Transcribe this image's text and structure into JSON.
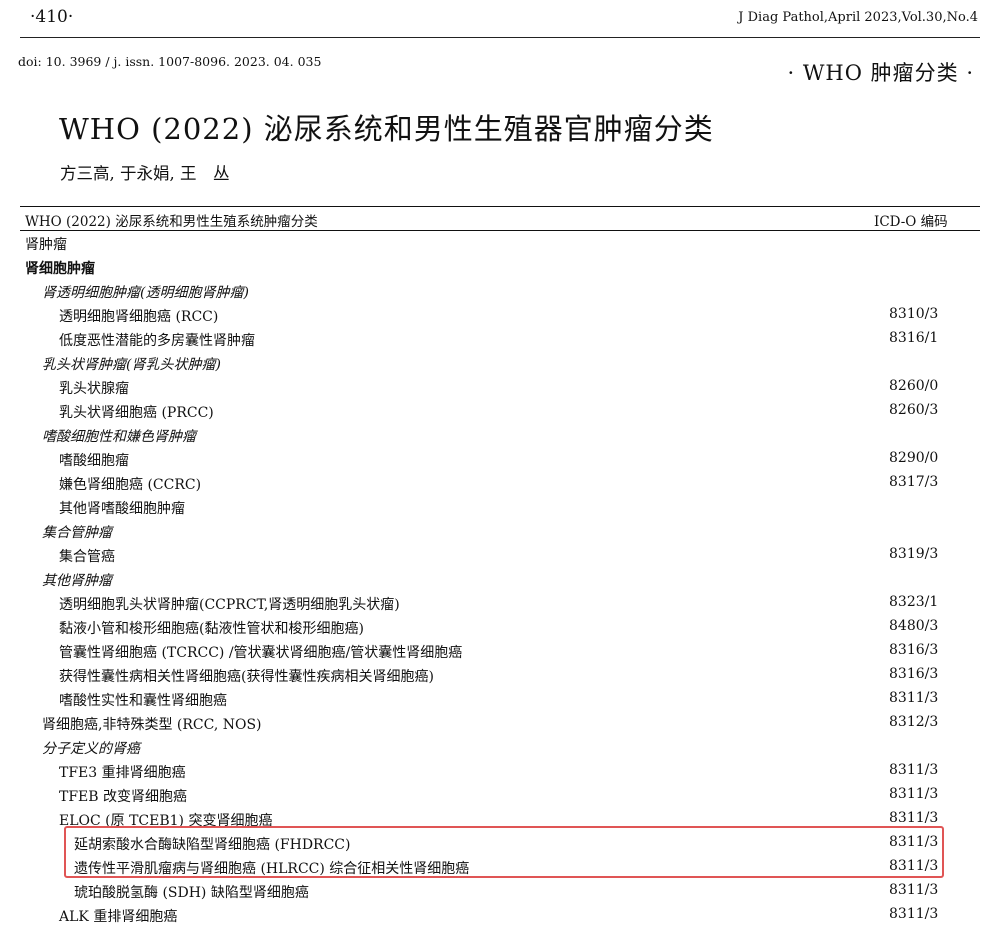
{
  "header": {
    "page_number": "·410·",
    "journal": "J Diag Pathol,April 2023,Vol.30,No.4",
    "doi": "doi: 10. 3969 / j. issn. 1007-8096. 2023. 04. 035",
    "category": "· WHO 肿瘤分类 ·"
  },
  "article": {
    "title": "WHO (2022) 泌尿系统和男性生殖器官肿瘤分类",
    "authors": "方三高, 于永娟, 王　丛"
  },
  "table": {
    "header_left": "WHO (2022) 泌尿系统和男性生殖系统肿瘤分类",
    "header_right": "ICD-O 编码",
    "rows": [
      {
        "name": "肾肿瘤",
        "code": ""
      },
      {
        "name": "肾细胞肿瘤",
        "code": ""
      },
      {
        "name": "肾透明细胞肿瘤(透明细胞肾肿瘤)",
        "code": ""
      },
      {
        "name": "透明细胞肾细胞癌 (RCC)",
        "code": "8310/3"
      },
      {
        "name": "低度恶性潜能的多房囊性肾肿瘤",
        "code": "8316/1"
      },
      {
        "name": "乳头状肾肿瘤(肾乳头状肿瘤)",
        "code": ""
      },
      {
        "name": "乳头状腺瘤",
        "code": "8260/0"
      },
      {
        "name": "乳头状肾细胞癌 (PRCC)",
        "code": "8260/3"
      },
      {
        "name": "嗜酸细胞性和嫌色肾肿瘤",
        "code": ""
      },
      {
        "name": "嗜酸细胞瘤",
        "code": "8290/0"
      },
      {
        "name": "嫌色肾细胞癌 (CCRC)",
        "code": "8317/3"
      },
      {
        "name": "其他肾嗜酸细胞肿瘤",
        "code": ""
      },
      {
        "name": "集合管肿瘤",
        "code": ""
      },
      {
        "name": "集合管癌",
        "code": "8319/3"
      },
      {
        "name": "其他肾肿瘤",
        "code": ""
      },
      {
        "name": "透明细胞乳头状肾肿瘤(CCPRCT,肾透明细胞乳头状瘤)",
        "code": "8323/1"
      },
      {
        "name": "黏液小管和梭形细胞癌(黏液性管状和梭形细胞癌)",
        "code": "8480/3"
      },
      {
        "name": "管囊性肾细胞癌 (TCRCC) /管状囊状肾细胞癌/管状囊性肾细胞癌",
        "code": "8316/3"
      },
      {
        "name": "获得性囊性病相关性肾细胞癌(获得性囊性疾病相关肾细胞癌)",
        "code": "8316/3"
      },
      {
        "name": "嗜酸性实性和囊性肾细胞癌",
        "code": "8311/3"
      },
      {
        "name": "肾细胞癌,非特殊类型 (RCC, NOS)",
        "code": "8312/3"
      },
      {
        "name": "分子定义的肾癌",
        "code": ""
      },
      {
        "name": "TFE3 重排肾细胞癌",
        "code": "8311/3"
      },
      {
        "name": "TFEB 改变肾细胞癌",
        "code": "8311/3"
      },
      {
        "name": "ELOC (原 TCEB1) 突变肾细胞癌",
        "code": "8311/3"
      },
      {
        "name": "延胡索酸水合酶缺陷型肾细胞癌 (FHDRCC)",
        "code": "8311/3"
      },
      {
        "name": "遗传性平滑肌瘤病与肾细胞癌 (HLRCC) 综合征相关性肾细胞癌",
        "code": "8311/3"
      },
      {
        "name": "琥珀酸脱氢酶 (SDH) 缺陷型肾细胞癌",
        "code": "8311/3"
      },
      {
        "name": "ALK 重排肾细胞癌",
        "code": "8311/3"
      }
    ]
  }
}
